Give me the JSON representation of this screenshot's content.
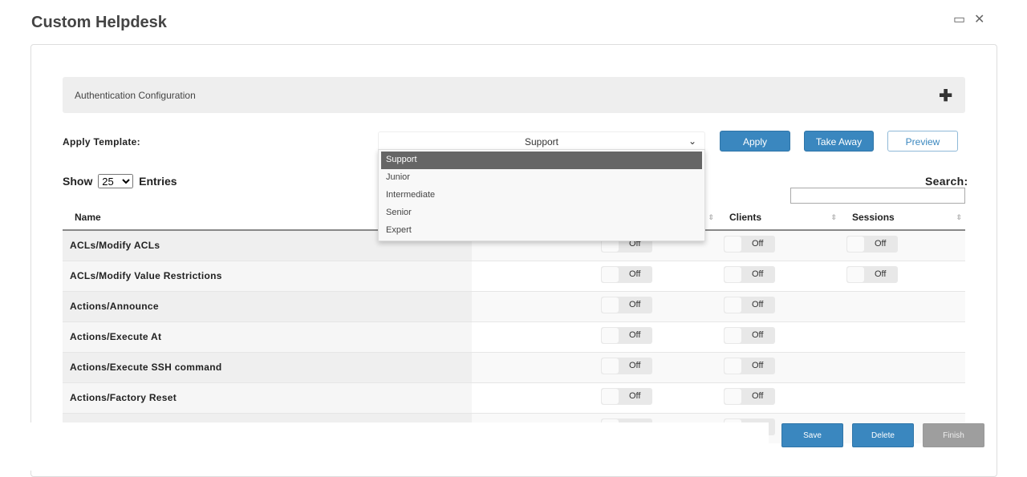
{
  "window": {
    "title": "Custom Helpdesk",
    "maximize_icon": "maximize-icon",
    "close_icon": "close-icon",
    "close_label": "✕",
    "max_label": "▭"
  },
  "accordion": {
    "label": "Authentication Configuration",
    "icon": "plus-icon",
    "icon_glyph": "✚"
  },
  "template": {
    "label": "Apply Template:",
    "selected": "Support",
    "options": [
      "Support",
      "Junior",
      "Intermediate",
      "Senior",
      "Expert"
    ]
  },
  "buttons": {
    "apply": "Apply",
    "take_away": "Take Away",
    "preview": "Preview",
    "save": "Save",
    "delete": "Delete",
    "finish": "Finish"
  },
  "entries": {
    "show": "Show",
    "value": "25",
    "entries": "Entries"
  },
  "search": {
    "label": "Search:",
    "value": ""
  },
  "table": {
    "headers": [
      "Name",
      "",
      "",
      "Clients",
      "Sessions"
    ],
    "rows": [
      {
        "name": "ACLs/Modify ACLs",
        "toggles": [
          "",
          "Off",
          "Off",
          "Off"
        ]
      },
      {
        "name": "ACLs/Modify Value Restrictions",
        "toggles": [
          "",
          "Off",
          "Off",
          "Off"
        ]
      },
      {
        "name": "Actions/Announce",
        "toggles": [
          "",
          "Off",
          "Off",
          ""
        ]
      },
      {
        "name": "Actions/Execute At",
        "toggles": [
          "",
          "Off",
          "Off",
          ""
        ]
      },
      {
        "name": "Actions/Execute SSH command",
        "toggles": [
          "",
          "Off",
          "Off",
          ""
        ]
      },
      {
        "name": "Actions/Factory Reset",
        "toggles": [
          "",
          "Off",
          "Off",
          ""
        ]
      },
      {
        "name": "",
        "toggles": [
          "",
          "Off",
          "Off",
          ""
        ]
      }
    ]
  },
  "colors": {
    "primary": "#3a87bf",
    "disabled": "#9e9e9e",
    "selected_option": "#666666"
  }
}
